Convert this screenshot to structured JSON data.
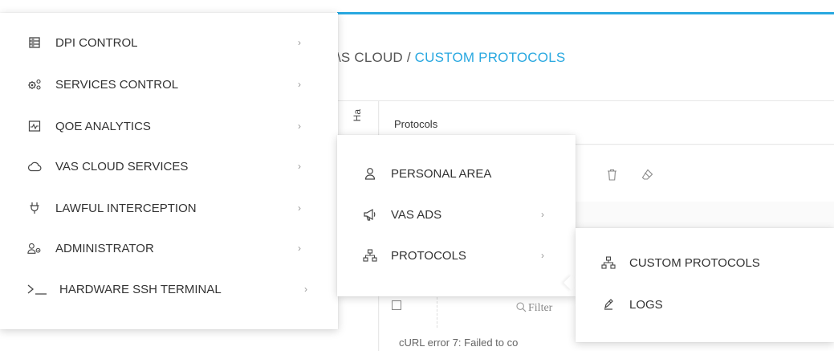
{
  "page": {
    "breadcrumb_parent": "\\S CLOUD / ",
    "breadcrumb_current": "CUSTOM PROTOCOLS",
    "side_tab_label": "Ha",
    "section_title": "Protocols",
    "filter_placeholder": "Filter",
    "error_message": "cURL error 7: Failed to co"
  },
  "menu_main": {
    "items": [
      {
        "label": "DPI CONTROL",
        "icon": "server-icon"
      },
      {
        "label": "SERVICES CONTROL",
        "icon": "gears-icon"
      },
      {
        "label": "QOE ANALYTICS",
        "icon": "pulse-chart-icon"
      },
      {
        "label": "VAS CLOUD SERVICES",
        "icon": "cloud-icon"
      },
      {
        "label": "LAWFUL INTERCEPTION",
        "icon": "plug-icon"
      },
      {
        "label": "ADMINISTRATOR",
        "icon": "user-gear-icon"
      },
      {
        "label": "HARDWARE SSH TERMINAL",
        "icon": "terminal-icon"
      }
    ]
  },
  "menu_sub1": {
    "items": [
      {
        "label": "PERSONAL AREA",
        "icon": "user-icon"
      },
      {
        "label": "VAS ADS",
        "icon": "megaphone-icon"
      },
      {
        "label": "PROTOCOLS",
        "icon": "network-icon"
      }
    ]
  },
  "menu_sub2": {
    "items": [
      {
        "label": "CUSTOM PROTOCOLS",
        "icon": "network-icon"
      },
      {
        "label": "LOGS",
        "icon": "logs-icon"
      }
    ]
  },
  "colors": {
    "accent": "#29a8e0",
    "text": "#333333",
    "chevron": "#999999"
  }
}
